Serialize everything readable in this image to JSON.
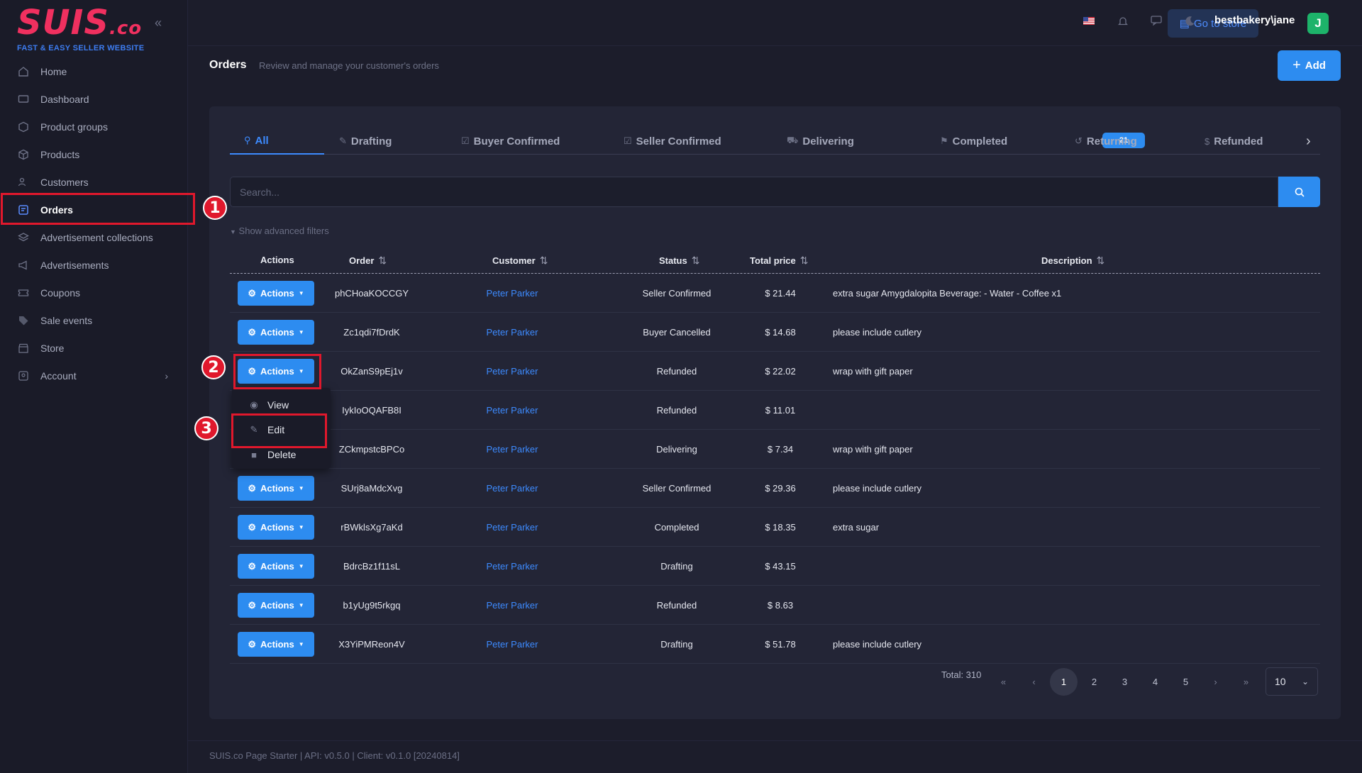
{
  "logo": {
    "main": "SUIS",
    "suffix": ".co",
    "tagline": "FAST & EASY SELLER WEBSITE"
  },
  "sidebar": {
    "items": [
      {
        "label": "Home",
        "icon": "home-icon"
      },
      {
        "label": "Dashboard",
        "icon": "monitor-icon"
      },
      {
        "label": "Product groups",
        "icon": "cube-icon"
      },
      {
        "label": "Products",
        "icon": "box-icon"
      },
      {
        "label": "Customers",
        "icon": "users-icon"
      },
      {
        "label": "Orders",
        "icon": "clipboard-icon"
      },
      {
        "label": "Advertisement collections",
        "icon": "layers-icon"
      },
      {
        "label": "Advertisements",
        "icon": "megaphone-icon"
      },
      {
        "label": "Coupons",
        "icon": "ticket-icon"
      },
      {
        "label": "Sale events",
        "icon": "tag-icon"
      },
      {
        "label": "Store",
        "icon": "store-icon"
      },
      {
        "label": "Account",
        "icon": "user-icon"
      }
    ]
  },
  "topbar": {
    "go_to_store": "Go to store",
    "user": "bestbakery\\jane",
    "avatar_letter": "J"
  },
  "page": {
    "title": "Orders",
    "subtitle": "Review and manage your customer's orders",
    "add_label": "Add"
  },
  "tabs": [
    {
      "label": "All"
    },
    {
      "label": "Drafting"
    },
    {
      "label": "Buyer Confirmed"
    },
    {
      "label": "Seller Confirmed"
    },
    {
      "label": "Delivering",
      "count": "21"
    },
    {
      "label": "Completed"
    },
    {
      "label": "Returning"
    },
    {
      "label": "Refunded"
    }
  ],
  "search": {
    "placeholder": "Search..."
  },
  "advanced_filters": "Show advanced filters",
  "table": {
    "headers": {
      "actions": "Actions",
      "order": "Order",
      "customer": "Customer",
      "status": "Status",
      "total": "Total price",
      "description": "Description"
    },
    "action_label": "Actions",
    "rows": [
      {
        "order": "phCHoaKOCCGY",
        "customer": "Peter Parker",
        "status": "Seller Confirmed",
        "total": "$ 21.44",
        "description": "extra sugar Amygdalopita Beverage: - Water - Coffee x1"
      },
      {
        "order": "Zc1qdi7fDrdK",
        "customer": "Peter Parker",
        "status": "Buyer Cancelled",
        "total": "$ 14.68",
        "description": "please include cutlery"
      },
      {
        "order": "OkZanS9pEj1v",
        "customer": "Peter Parker",
        "status": "Refunded",
        "total": "$ 22.02",
        "description": "wrap with gift paper"
      },
      {
        "order": "IykIoOQAFB8I",
        "customer": "Peter Parker",
        "status": "Refunded",
        "total": "$ 11.01",
        "description": ""
      },
      {
        "order": "ZCkmpstcBPCo",
        "customer": "Peter Parker",
        "status": "Delivering",
        "total": "$ 7.34",
        "description": "wrap with gift paper"
      },
      {
        "order": "SUrj8aMdcXvg",
        "customer": "Peter Parker",
        "status": "Seller Confirmed",
        "total": "$ 29.36",
        "description": "please include cutlery"
      },
      {
        "order": "rBWklsXg7aKd",
        "customer": "Peter Parker",
        "status": "Completed",
        "total": "$ 18.35",
        "description": "extra sugar"
      },
      {
        "order": "BdrcBz1f11sL",
        "customer": "Peter Parker",
        "status": "Drafting",
        "total": "$ 43.15",
        "description": ""
      },
      {
        "order": "b1yUg9t5rkgq",
        "customer": "Peter Parker",
        "status": "Refunded",
        "total": "$ 8.63",
        "description": ""
      },
      {
        "order": "X3YiPMReon4V",
        "customer": "Peter Parker",
        "status": "Drafting",
        "total": "$ 51.78",
        "description": "please include cutlery"
      }
    ]
  },
  "dropdown": {
    "view": "View",
    "edit": "Edit",
    "delete": "Delete"
  },
  "annotations": [
    "1",
    "2",
    "3"
  ],
  "pagination": {
    "total": "Total: 310",
    "pages": [
      "1",
      "2",
      "3",
      "4",
      "5"
    ],
    "page_size": "10"
  },
  "footer": "SUIS.co Page Starter | API: v0.5.0 | Client: v0.1.0 [20240814]"
}
